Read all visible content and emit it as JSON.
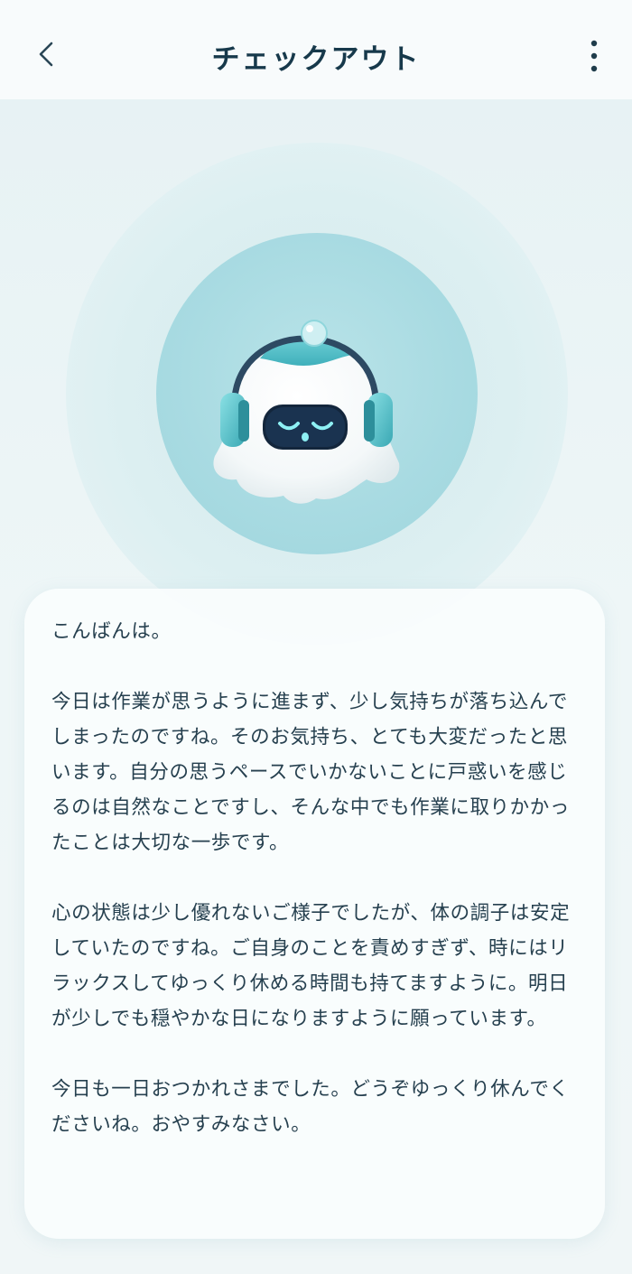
{
  "header": {
    "title": "チェックアウト",
    "back_icon": "chevron-left-icon",
    "more_icon": "more-vertical-icon"
  },
  "mascot": {
    "icon": "robot-headphones-mascot"
  },
  "message": {
    "paragraphs": [
      "こんばんは。",
      "今日は作業が思うように進まず、少し気持ちが落ち込んでしまったのですね。そのお気持ち、とても大変だったと思います。自分の思うペースでいかないことに戸惑いを感じるのは自然なことですし、そんな中でも作業に取りかかったことは大切な一歩です。",
      "心の状態は少し優れないご様子でしたが、体の調子は安定していたのですね。ご自身のことを責めすぎず、時にはリラックスしてゆっくり休める時間も持てますように。明日が少しでも穏やかな日になりますように願っています。",
      "今日も一日おつかれさまでした。どうぞゆっくり休んでくださいね。おやすみなさい。"
    ]
  },
  "colors": {
    "title": "#17394b",
    "text": "#26404f",
    "accent": "#5fc2cb",
    "background": "#eef5f6"
  }
}
